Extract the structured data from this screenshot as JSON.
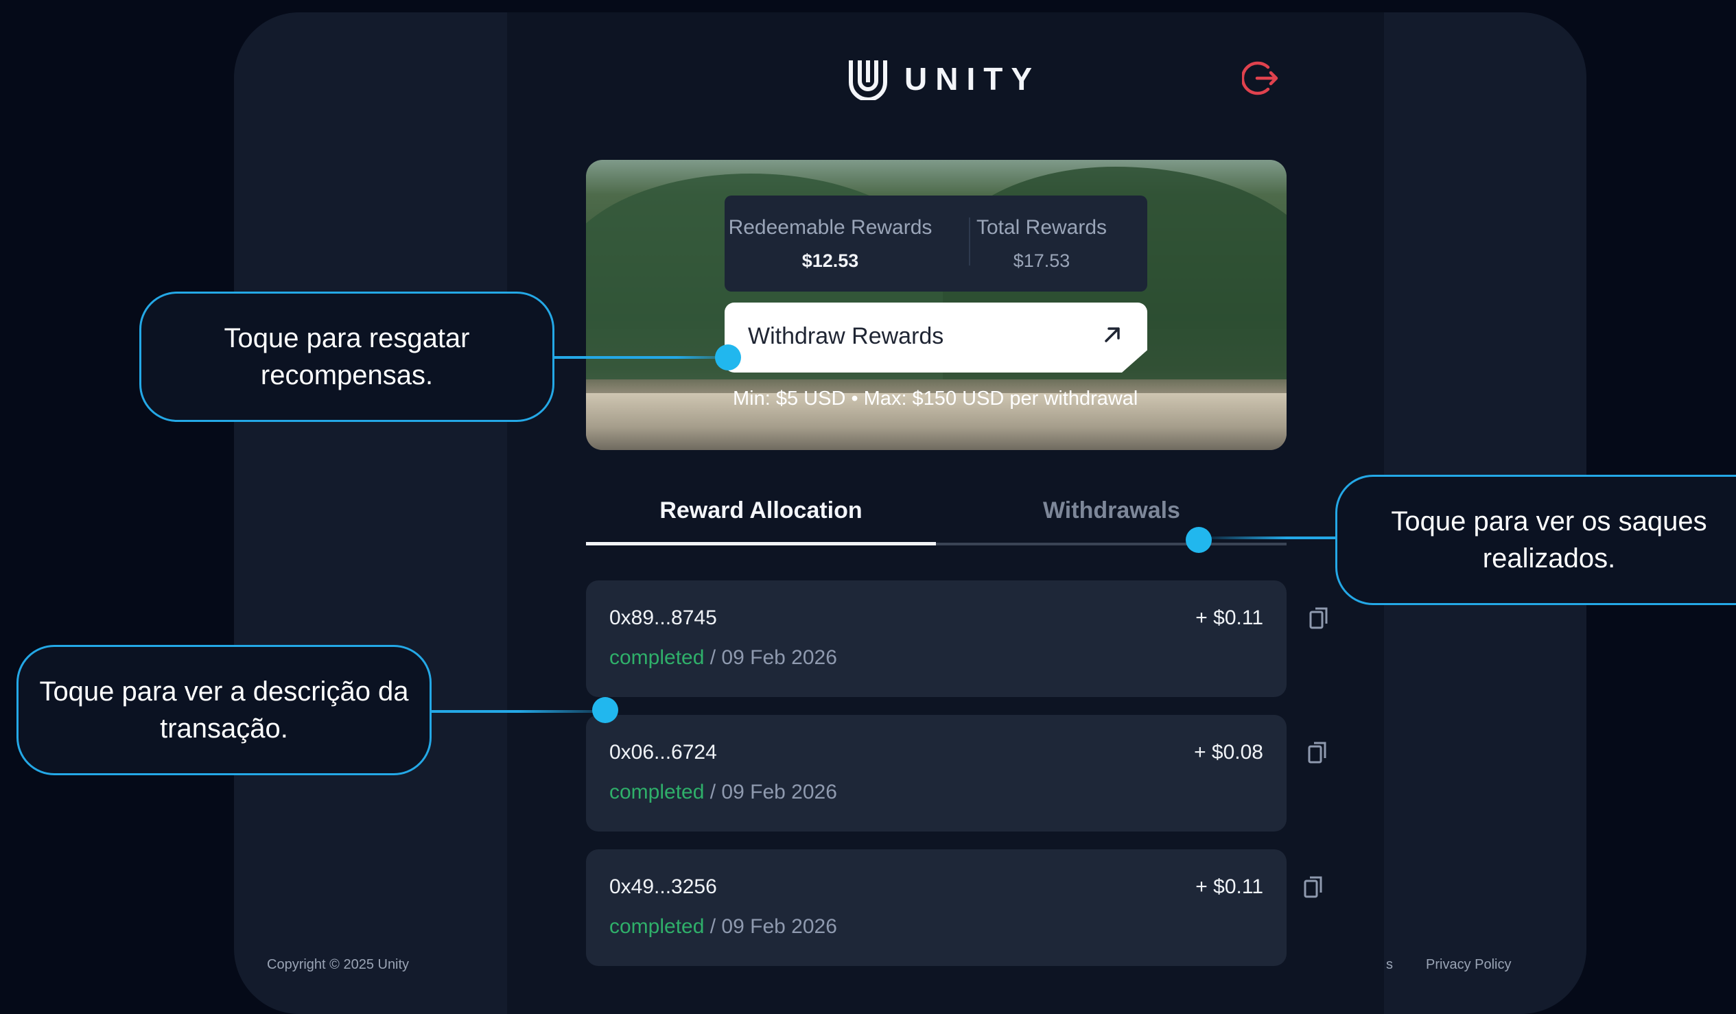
{
  "brand": {
    "name": "UNITY",
    "logo_icon": "unity-u-logo-icon",
    "logout_icon": "logout-icon",
    "logout_color": "#e0424e"
  },
  "rewards": {
    "redeemable_label": "Redeemable Rewards",
    "redeemable_value": "$12.53",
    "total_label": "Total Rewards",
    "total_value": "$17.53",
    "withdraw_label": "Withdraw Rewards",
    "withdraw_icon": "arrow-up-right-icon",
    "limits_text": "Min: $5 USD • Max: $150 USD per withdrawal"
  },
  "tabs": [
    {
      "label": "Reward Allocation",
      "active": true
    },
    {
      "label": "Withdrawals",
      "active": false
    }
  ],
  "transactions": [
    {
      "hash": "0x89...8745",
      "amount": "+ $0.11",
      "status": "completed",
      "date": "/ 09 Feb 2026"
    },
    {
      "hash": "0x06...6724",
      "amount": "+ $0.08",
      "status": "completed",
      "date": "/ 09 Feb 2026"
    },
    {
      "hash": "0x49...3256",
      "amount": "+ $0.11",
      "status": "completed",
      "date": "/ 09 Feb 2026"
    }
  ],
  "footer": {
    "copyright": "Copyright © 2025 Unity",
    "partial_link": "s",
    "privacy": "Privacy Policy"
  },
  "callouts": {
    "withdraw": "Toque para resgatar recompensas.",
    "withdrawals_tab": "Toque para ver os saques realizados.",
    "transaction": "Toque para ver a descrição da transação."
  },
  "colors": {
    "accent": "#21b7ee",
    "completed": "#2fb06a",
    "background": "#050a18"
  }
}
